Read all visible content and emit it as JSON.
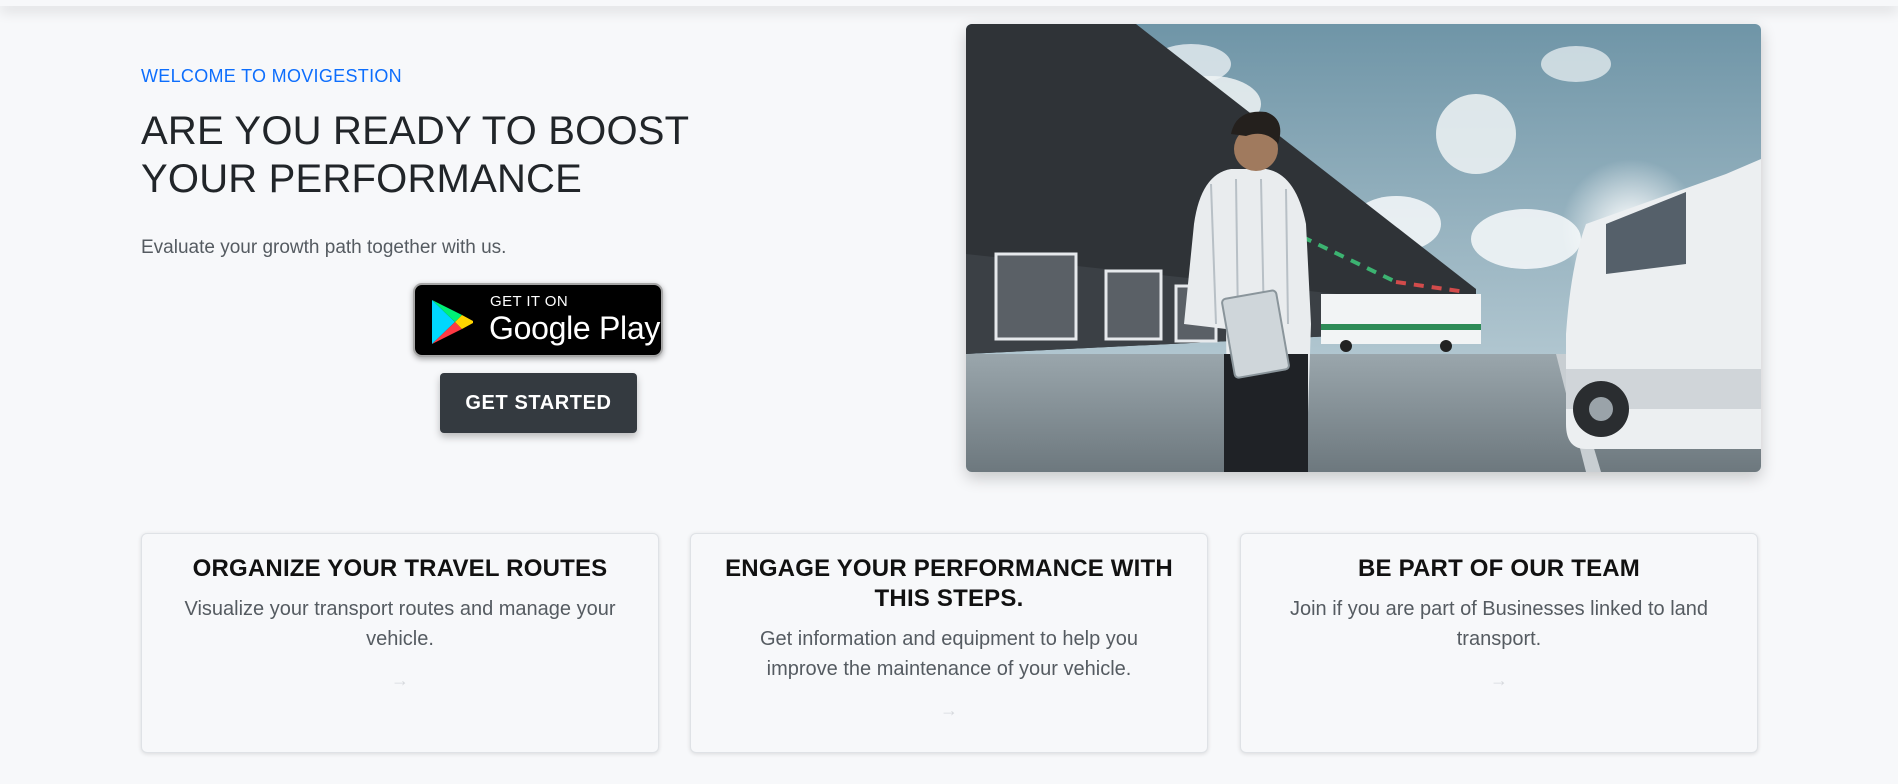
{
  "hero": {
    "eyebrow": "WELCOME TO MOVIGESTION",
    "headline": "ARE YOU READY TO BOOST YOUR PERFORMANCE",
    "subtitle": "Evaluate your growth path together with us.",
    "store_badge": {
      "small_text": "GET IT ON",
      "big_text": "Google Play",
      "icon": "google-play-icon"
    },
    "cta_label": "GET STARTED",
    "image_description_icon": "hero-warehouse-photo"
  },
  "cards": [
    {
      "title": "ORGANIZE YOUR TRAVEL ROUTES",
      "text": "Visualize your transport routes and manage your vehicle.",
      "arrow": "→"
    },
    {
      "title": "ENGAGE YOUR PERFORMANCE WITH THIS STEPS.",
      "text": "Get information and equipment to help you improve the maintenance of your vehicle.",
      "arrow": "→"
    },
    {
      "title": "BE PART OF OUR TEAM",
      "text": "Join if you are part of Businesses linked to land transport.",
      "arrow": "→"
    }
  ],
  "colors": {
    "accent": "#0d6efd",
    "button_dark": "#343a40",
    "background": "#f7f8fa"
  }
}
